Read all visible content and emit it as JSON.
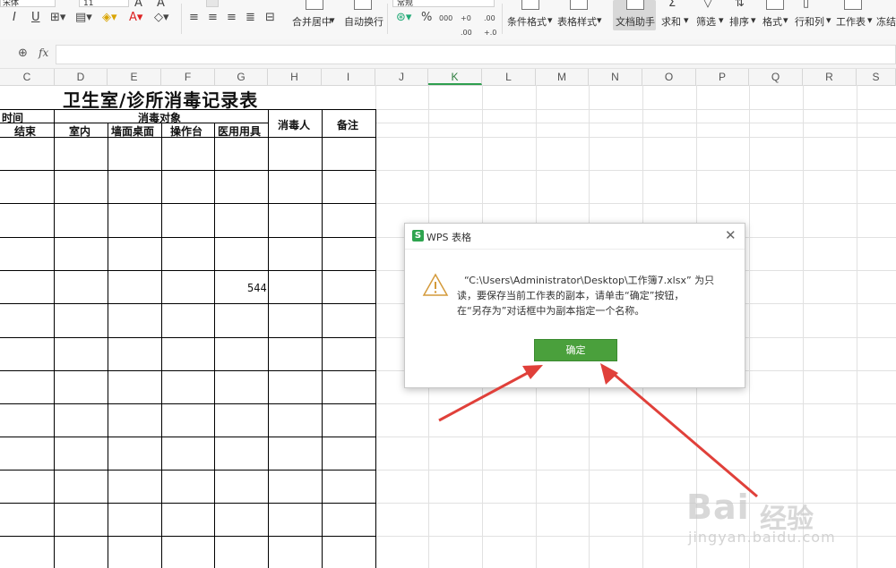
{
  "ribbon": {
    "font_name": "宋体",
    "font_size": "11",
    "number_format": "常规",
    "buttons": {
      "merge_center": "合并居中",
      "wrap_text": "自动换行",
      "cond_format": "条件格式",
      "table_style": "表格样式",
      "doc_helper": "文档助手",
      "sum": "求和",
      "filter": "筛选",
      "sort": "排序",
      "format": "格式",
      "row_col": "行和列",
      "worksheet": "工作表",
      "freeze": "冻结"
    },
    "percent": "%",
    "thousands": "000",
    "dec_inc": "+.0 .00",
    "dec_dec": ".00 +.0"
  },
  "formula_bar": {
    "fx_label": "fx",
    "value": ""
  },
  "columns": [
    "C",
    "D",
    "E",
    "F",
    "G",
    "H",
    "I",
    "J",
    "K",
    "L",
    "M",
    "N",
    "O",
    "P",
    "Q",
    "R",
    "S"
  ],
  "sheet": {
    "title": "卫生室/诊所消毒记录表",
    "headers": {
      "time": "时间",
      "end": "结束",
      "disinfect_target": "消毒对象",
      "indoor": "室内",
      "wall_desk": "墙面桌面",
      "operating_table": "操作台",
      "medical_items": "医用用具",
      "disinfector": "消毒人",
      "remarks": "备注"
    },
    "cell_value": "544"
  },
  "dialog": {
    "title": "WPS 表格",
    "logo_letter": "S",
    "message_line1": "“C:\\Users\\Administrator\\Desktop\\工作簿7.xlsx”  为只",
    "message_line2": "读，要保存当前工作表的副本，请单击“确定”按钮，",
    "message_line3": "在“另存为”对话框中为副本指定一个名称。",
    "ok_label": "确定"
  },
  "watermark": {
    "brand": "Bai",
    "brand2": "经验",
    "url": "jingyan.baidu.com"
  },
  "colors": {
    "accent": "#4aa03c",
    "arrow": "#e0403a",
    "grid": "#e1e1e1",
    "table_border": "#000000"
  }
}
